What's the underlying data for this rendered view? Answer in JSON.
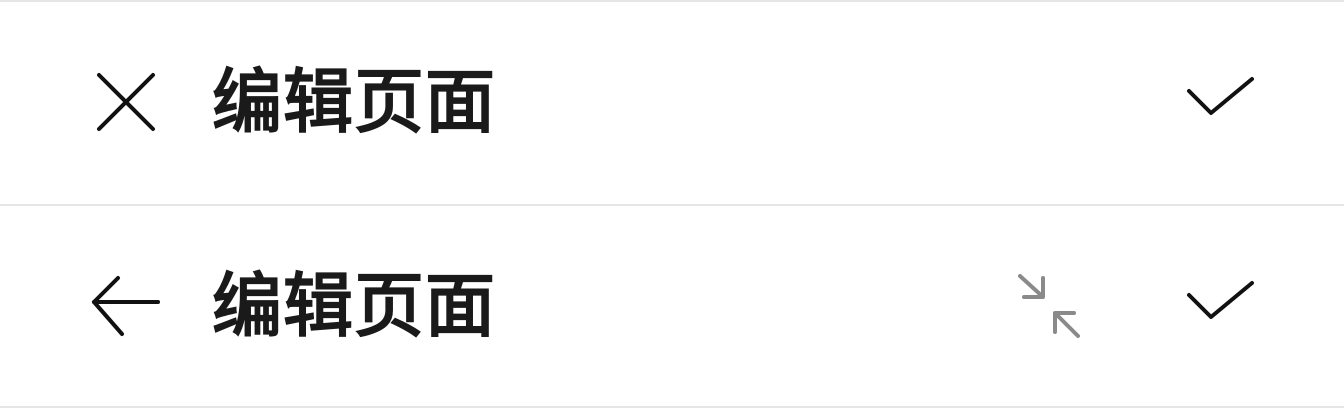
{
  "edit_bar": {
    "title": "编辑页面",
    "leading_icon": "close-icon",
    "trailing_icons": [
      "check-icon"
    ]
  },
  "edit_bar_secondary": {
    "title": "编辑页面",
    "leading_icon": "back-arrow-icon",
    "trailing_icons": [
      "collapse-icon",
      "check-icon"
    ]
  },
  "colors": {
    "icon": "#111111",
    "icon_muted": "#8a8a8a",
    "text": "#1a1a1a",
    "divider": "#e6e6e6",
    "background": "#ffffff"
  }
}
